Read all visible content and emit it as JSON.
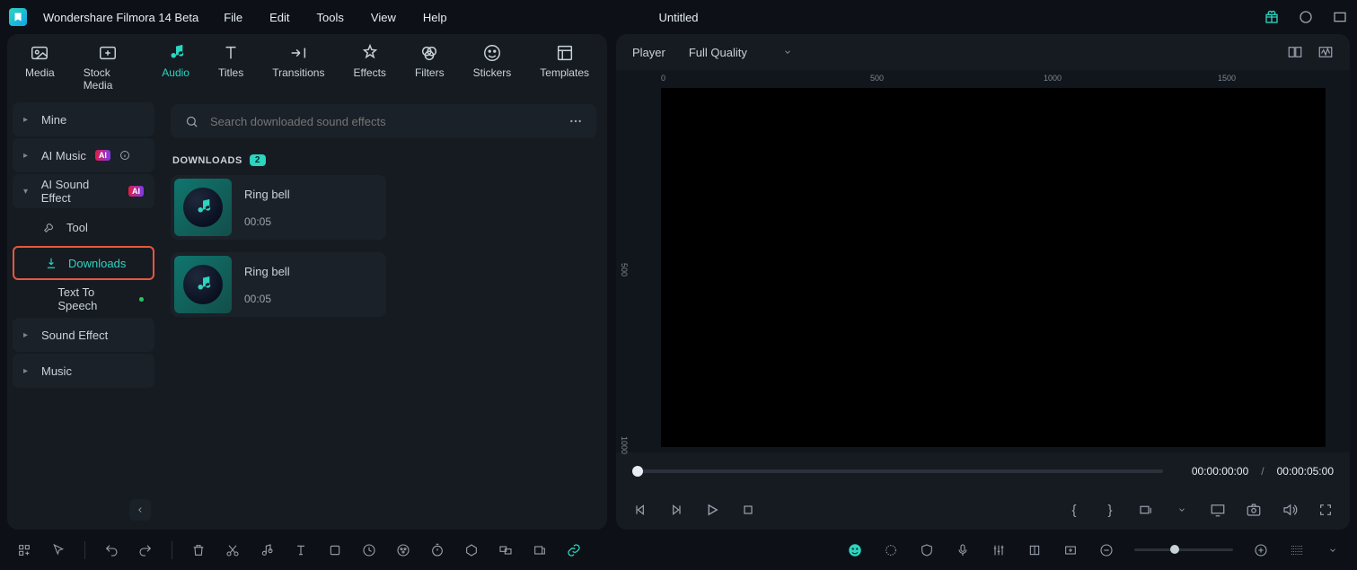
{
  "app_title": "Wondershare Filmora 14 Beta",
  "menus": [
    "File",
    "Edit",
    "Tools",
    "View",
    "Help"
  ],
  "document": "Untitled",
  "tabs": [
    {
      "label": "Media"
    },
    {
      "label": "Stock Media"
    },
    {
      "label": "Audio"
    },
    {
      "label": "Titles"
    },
    {
      "label": "Transitions"
    },
    {
      "label": "Effects"
    },
    {
      "label": "Filters"
    },
    {
      "label": "Stickers"
    },
    {
      "label": "Templates"
    }
  ],
  "sidebar": {
    "mine": "Mine",
    "aimusic": "AI Music",
    "aisound": "AI Sound Effect",
    "tool": "Tool",
    "downloads": "Downloads",
    "tts": "Text To Speech",
    "soundeffect": "Sound Effect",
    "music": "Music",
    "ai_badge": "AI"
  },
  "search_placeholder": "Search downloaded sound effects",
  "section": {
    "label": "DOWNLOADS",
    "count": "2"
  },
  "cards": [
    {
      "title": "Ring bell",
      "duration": "00:05"
    },
    {
      "title": "Ring bell",
      "duration": "00:05"
    }
  ],
  "player": {
    "label": "Player",
    "quality": "Full Quality"
  },
  "ruler_h": [
    "0",
    "500",
    "1000",
    "1500"
  ],
  "ruler_v": [
    "500",
    "1000"
  ],
  "time": {
    "current": "00:00:00:00",
    "sep": "/",
    "total": "00:00:05:00"
  },
  "brackets": {
    "open": "{",
    "close": "}"
  }
}
